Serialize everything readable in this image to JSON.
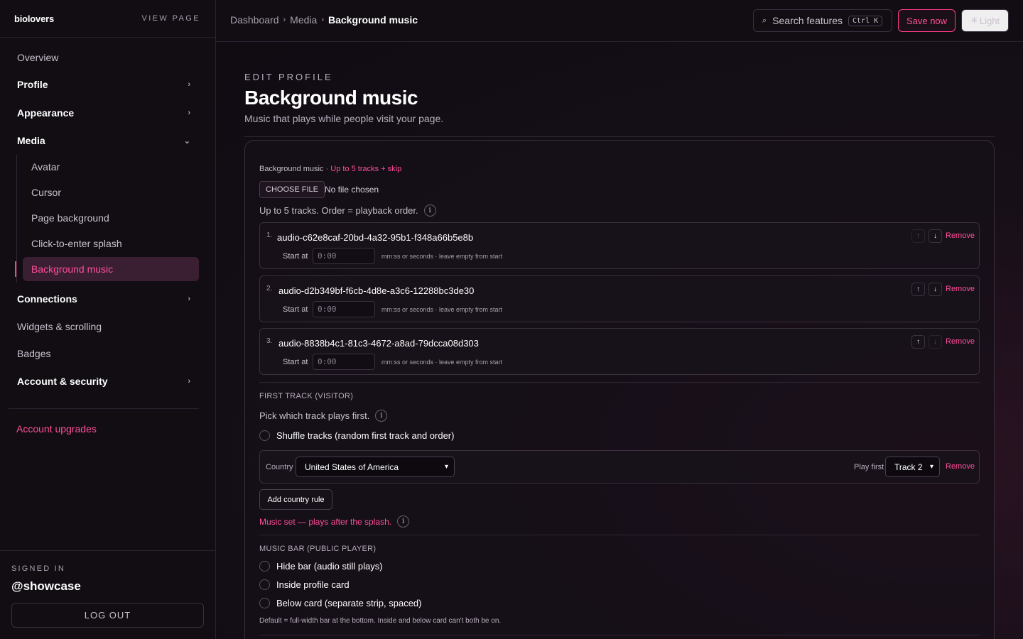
{
  "sidebar": {
    "brand": "biolovers",
    "view_page": "VIEW PAGE",
    "items": [
      {
        "label": "Overview"
      },
      {
        "label": "Profile"
      },
      {
        "label": "Appearance"
      },
      {
        "label": "Media"
      },
      {
        "label": "Connections"
      },
      {
        "label": "Widgets & scrolling"
      },
      {
        "label": "Badges"
      },
      {
        "label": "Account & security"
      }
    ],
    "media_sub": [
      {
        "label": "Avatar"
      },
      {
        "label": "Cursor"
      },
      {
        "label": "Page background"
      },
      {
        "label": "Click-to-enter splash"
      },
      {
        "label": "Background music"
      }
    ],
    "upgrades": "Account upgrades",
    "signed_in_label": "SIGNED IN",
    "handle": "@showcase",
    "logout": "LOG OUT"
  },
  "topbar": {
    "breadcrumb": [
      "Dashboard",
      "Media",
      "Background music"
    ],
    "search_label": "Search features",
    "search_kbd": "Ctrl K",
    "save_label": "Save now",
    "theme_label": "Light"
  },
  "page": {
    "eyebrow": "EDIT PROFILE",
    "title": "Background music",
    "subtitle": "Music that plays while people visit your page."
  },
  "music": {
    "label": "Background music",
    "label_accent": "· Up to 5 tracks + skip",
    "choose_file": "CHOOSE FILE",
    "no_file": "No file chosen",
    "help": "Up to 5 tracks. Order = playback order.",
    "start_label": "Start at",
    "start_placeholder": "0:00",
    "start_hint": "mm:ss or seconds · leave empty from start",
    "remove_label": "Remove",
    "tracks": [
      {
        "num": "1.",
        "name": "audio-c62e8caf-20bd-4a32-95b1-f348a66b5e8b"
      },
      {
        "num": "2.",
        "name": "audio-d2b349bf-f6cb-4d8e-a3c6-12288bc3de30"
      },
      {
        "num": "3.",
        "name": "audio-8838b4c1-81c3-4672-a8ad-79dcca08d303"
      }
    ]
  },
  "first_track": {
    "title": "FIRST TRACK (VISITOR)",
    "help": "Pick which track plays first.",
    "shuffle_label": "Shuffle tracks (random first track and order)",
    "country_label": "Country",
    "country_value": "United States of America",
    "play_first_label": "Play first",
    "play_first_value": "Track 2",
    "remove_label": "Remove",
    "add_rule": "Add country rule",
    "status": "Music set — plays after the splash."
  },
  "music_bar": {
    "title": "MUSIC BAR (PUBLIC PLAYER)",
    "options": [
      {
        "label": "Hide bar (audio still plays)"
      },
      {
        "label": "Inside profile card"
      },
      {
        "label": "Below card (separate strip, spaced)"
      }
    ],
    "note": "Default = full-width bar at the bottom. Inside and below card can't both be on."
  },
  "colors": {
    "accent": "#ff3d8b",
    "background": "#0e0b10"
  }
}
